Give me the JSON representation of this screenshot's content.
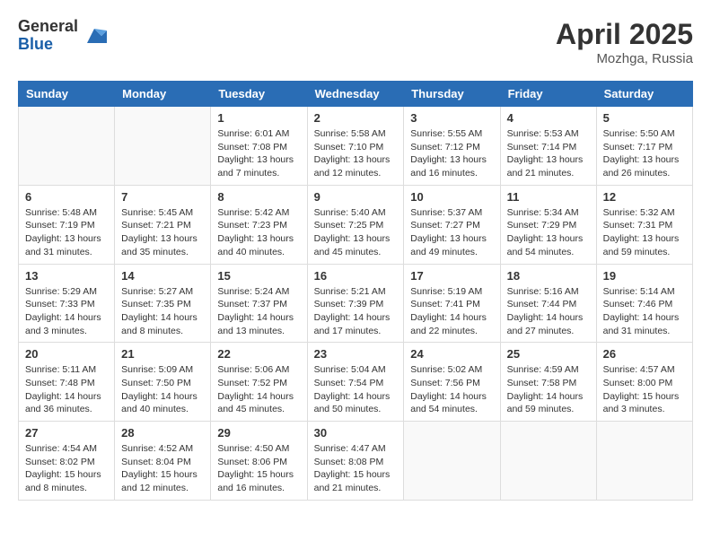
{
  "logo": {
    "general": "General",
    "blue": "Blue"
  },
  "title": {
    "month_year": "April 2025",
    "location": "Mozhga, Russia"
  },
  "weekdays": [
    "Sunday",
    "Monday",
    "Tuesday",
    "Wednesday",
    "Thursday",
    "Friday",
    "Saturday"
  ],
  "weeks": [
    [
      {
        "day": "",
        "content": ""
      },
      {
        "day": "",
        "content": ""
      },
      {
        "day": "1",
        "content": "Sunrise: 6:01 AM\nSunset: 7:08 PM\nDaylight: 13 hours and 7 minutes."
      },
      {
        "day": "2",
        "content": "Sunrise: 5:58 AM\nSunset: 7:10 PM\nDaylight: 13 hours and 12 minutes."
      },
      {
        "day": "3",
        "content": "Sunrise: 5:55 AM\nSunset: 7:12 PM\nDaylight: 13 hours and 16 minutes."
      },
      {
        "day": "4",
        "content": "Sunrise: 5:53 AM\nSunset: 7:14 PM\nDaylight: 13 hours and 21 minutes."
      },
      {
        "day": "5",
        "content": "Sunrise: 5:50 AM\nSunset: 7:17 PM\nDaylight: 13 hours and 26 minutes."
      }
    ],
    [
      {
        "day": "6",
        "content": "Sunrise: 5:48 AM\nSunset: 7:19 PM\nDaylight: 13 hours and 31 minutes."
      },
      {
        "day": "7",
        "content": "Sunrise: 5:45 AM\nSunset: 7:21 PM\nDaylight: 13 hours and 35 minutes."
      },
      {
        "day": "8",
        "content": "Sunrise: 5:42 AM\nSunset: 7:23 PM\nDaylight: 13 hours and 40 minutes."
      },
      {
        "day": "9",
        "content": "Sunrise: 5:40 AM\nSunset: 7:25 PM\nDaylight: 13 hours and 45 minutes."
      },
      {
        "day": "10",
        "content": "Sunrise: 5:37 AM\nSunset: 7:27 PM\nDaylight: 13 hours and 49 minutes."
      },
      {
        "day": "11",
        "content": "Sunrise: 5:34 AM\nSunset: 7:29 PM\nDaylight: 13 hours and 54 minutes."
      },
      {
        "day": "12",
        "content": "Sunrise: 5:32 AM\nSunset: 7:31 PM\nDaylight: 13 hours and 59 minutes."
      }
    ],
    [
      {
        "day": "13",
        "content": "Sunrise: 5:29 AM\nSunset: 7:33 PM\nDaylight: 14 hours and 3 minutes."
      },
      {
        "day": "14",
        "content": "Sunrise: 5:27 AM\nSunset: 7:35 PM\nDaylight: 14 hours and 8 minutes."
      },
      {
        "day": "15",
        "content": "Sunrise: 5:24 AM\nSunset: 7:37 PM\nDaylight: 14 hours and 13 minutes."
      },
      {
        "day": "16",
        "content": "Sunrise: 5:21 AM\nSunset: 7:39 PM\nDaylight: 14 hours and 17 minutes."
      },
      {
        "day": "17",
        "content": "Sunrise: 5:19 AM\nSunset: 7:41 PM\nDaylight: 14 hours and 22 minutes."
      },
      {
        "day": "18",
        "content": "Sunrise: 5:16 AM\nSunset: 7:44 PM\nDaylight: 14 hours and 27 minutes."
      },
      {
        "day": "19",
        "content": "Sunrise: 5:14 AM\nSunset: 7:46 PM\nDaylight: 14 hours and 31 minutes."
      }
    ],
    [
      {
        "day": "20",
        "content": "Sunrise: 5:11 AM\nSunset: 7:48 PM\nDaylight: 14 hours and 36 minutes."
      },
      {
        "day": "21",
        "content": "Sunrise: 5:09 AM\nSunset: 7:50 PM\nDaylight: 14 hours and 40 minutes."
      },
      {
        "day": "22",
        "content": "Sunrise: 5:06 AM\nSunset: 7:52 PM\nDaylight: 14 hours and 45 minutes."
      },
      {
        "day": "23",
        "content": "Sunrise: 5:04 AM\nSunset: 7:54 PM\nDaylight: 14 hours and 50 minutes."
      },
      {
        "day": "24",
        "content": "Sunrise: 5:02 AM\nSunset: 7:56 PM\nDaylight: 14 hours and 54 minutes."
      },
      {
        "day": "25",
        "content": "Sunrise: 4:59 AM\nSunset: 7:58 PM\nDaylight: 14 hours and 59 minutes."
      },
      {
        "day": "26",
        "content": "Sunrise: 4:57 AM\nSunset: 8:00 PM\nDaylight: 15 hours and 3 minutes."
      }
    ],
    [
      {
        "day": "27",
        "content": "Sunrise: 4:54 AM\nSunset: 8:02 PM\nDaylight: 15 hours and 8 minutes."
      },
      {
        "day": "28",
        "content": "Sunrise: 4:52 AM\nSunset: 8:04 PM\nDaylight: 15 hours and 12 minutes."
      },
      {
        "day": "29",
        "content": "Sunrise: 4:50 AM\nSunset: 8:06 PM\nDaylight: 15 hours and 16 minutes."
      },
      {
        "day": "30",
        "content": "Sunrise: 4:47 AM\nSunset: 8:08 PM\nDaylight: 15 hours and 21 minutes."
      },
      {
        "day": "",
        "content": ""
      },
      {
        "day": "",
        "content": ""
      },
      {
        "day": "",
        "content": ""
      }
    ]
  ]
}
